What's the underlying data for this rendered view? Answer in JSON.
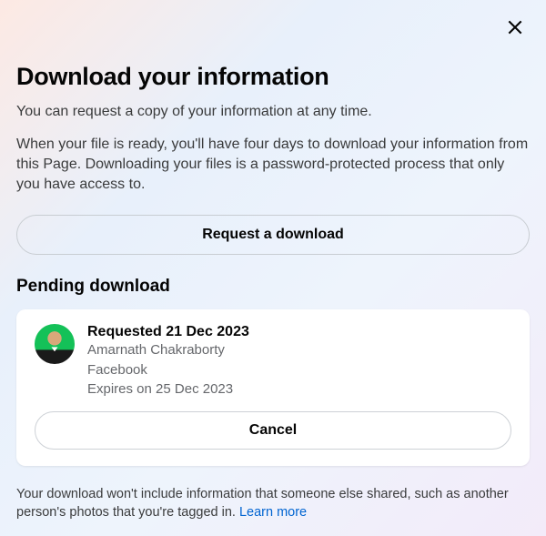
{
  "header": {
    "title": "Download your information"
  },
  "intro": "You can request a copy of your information at any time.",
  "detail": "When your file is ready, you'll have four days to download your information from this Page. Downloading your files is a password-protected process that only you have access to.",
  "request_button": "Request a download",
  "pending": {
    "heading": "Pending download",
    "requests": [
      {
        "requested_line": "Requested 21 Dec 2023",
        "name": "Amarnath Chakraborty",
        "source": "Facebook",
        "expires": "Expires on 25 Dec 2023"
      }
    ],
    "cancel_button": "Cancel"
  },
  "footer": {
    "text": "Your download won't include information that someone else shared, such as another person's photos that you're tagged in. ",
    "link": "Learn more"
  }
}
